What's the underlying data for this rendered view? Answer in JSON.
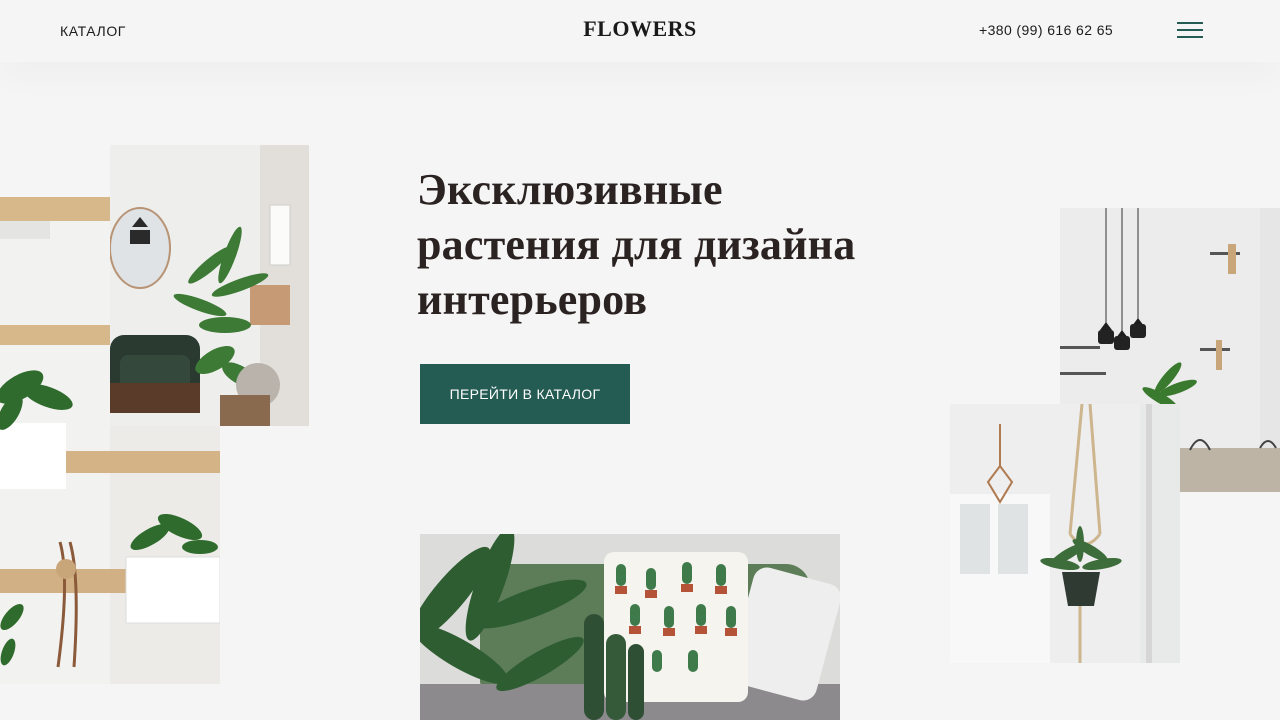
{
  "header": {
    "nav_catalog": "КАТАЛОГ",
    "logo": "FLOWERS",
    "phone": "+380 (99) 616 62 65",
    "menu_icon": "burger-menu-icon"
  },
  "hero": {
    "title_lines": [
      "Эксклюзивные",
      "растения для дизайна",
      "интерьеров"
    ],
    "cta_label": "ПЕРЕЙТИ В КАТАЛОГ"
  },
  "images": [
    "interior-shelves-photo",
    "interior-mirror-armchair-photo",
    "pendant-lamps-room-photo",
    "macrame-hanging-planter-photo",
    "sofa-cactus-pillow-photo"
  ],
  "colors": {
    "background": "#f5f5f5",
    "accent": "#245b53",
    "text": "#2b2222"
  }
}
